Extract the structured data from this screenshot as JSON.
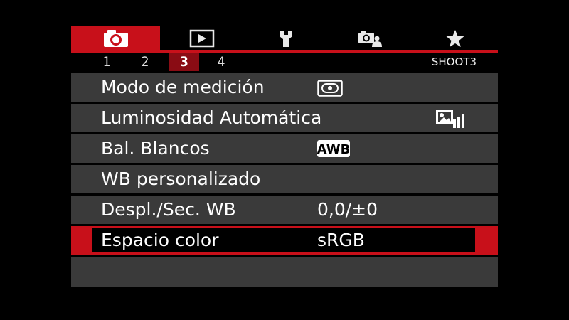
{
  "tabs": [
    {
      "name": "shoot",
      "icon": "camera-icon",
      "active": true
    },
    {
      "name": "playback",
      "icon": "play-icon",
      "active": false
    },
    {
      "name": "setup",
      "icon": "wrench-icon",
      "active": false
    },
    {
      "name": "custom",
      "icon": "custom-functions-icon",
      "active": false
    },
    {
      "name": "mymenu",
      "icon": "star-icon",
      "active": false
    }
  ],
  "pages": [
    "1",
    "2",
    "3",
    "4"
  ],
  "active_page": "3",
  "page_id": "SHOOT3",
  "menu": {
    "items": [
      {
        "label": "Modo de medición",
        "value": "",
        "value_icon": "metering-evaluative-icon"
      },
      {
        "label": "Luminosidad Automática",
        "value": "",
        "value_icon": "auto-lighting-optimizer-icon"
      },
      {
        "label": "Bal. Blancos",
        "value": "",
        "value_icon": "awb-icon",
        "value_icon_text": "AWB"
      },
      {
        "label": "WB personalizado",
        "value": ""
      },
      {
        "label": "Despl./Sec. WB",
        "value": "0,0/±0"
      },
      {
        "label": "Espacio color",
        "value": "sRGB"
      }
    ],
    "selected_index": 5
  },
  "colors": {
    "accent": "#c8101a",
    "page_active": "#8a0c14",
    "row_bg": "#3a3a3a",
    "background": "#000000",
    "text": "#ffffff"
  }
}
